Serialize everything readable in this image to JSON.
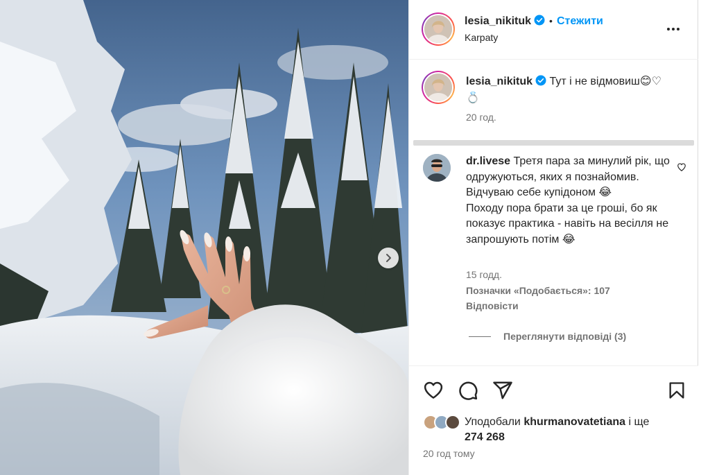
{
  "post": {
    "username": "lesia_nikituk",
    "follow_label": "Стежити",
    "dot": "•",
    "location": "Karpaty",
    "caption": "Тут і не відмовиш😊♡💍",
    "caption_time": "20 год."
  },
  "comment": {
    "username": "dr.livese",
    "text_part1": "Третя пара за минулий рік, що одружуються, яких я познайомив. Відчуваю себе купідоном 😂",
    "text_part2": "Походу пора брати за це гроші, бо як показує практика - навіть на весілля не запрошують потім 😂",
    "time": "15 годд.",
    "likes": "Позначки «Подобається»: 107",
    "reply": "Відповісти",
    "view_replies": "Переглянути відповіді (3)"
  },
  "footer": {
    "liked_by_prefix": "Уподобали",
    "liked_by_user": "khurmanovatetiana",
    "liked_by_and": "і ще",
    "liked_by_count": "274 268",
    "posted_ago": "20 год тому"
  },
  "colors": {
    "accent": "#0095f6",
    "verified": "#0095f6",
    "muted": "#737373"
  },
  "icons": [
    "verified-icon",
    "more-icon",
    "chevron-right-icon",
    "heart-icon",
    "comment-icon",
    "share-icon",
    "bookmark-icon"
  ]
}
